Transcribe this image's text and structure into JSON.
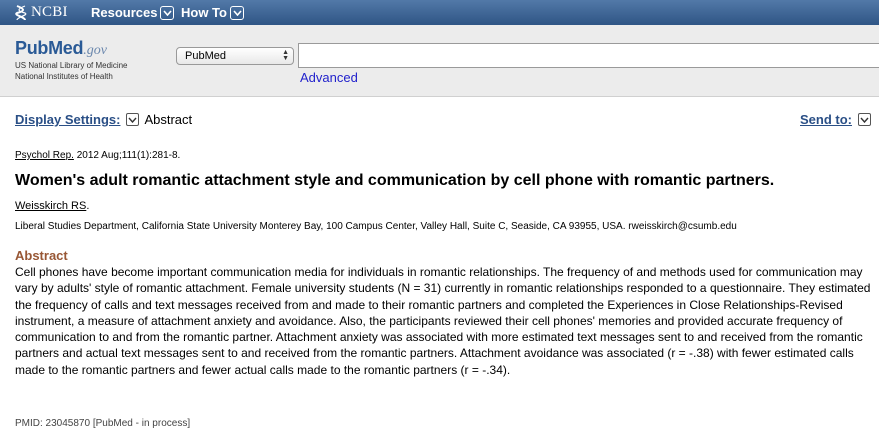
{
  "topbar": {
    "logo_text": "NCBI",
    "nav": [
      {
        "label": "Resources"
      },
      {
        "label": "How To"
      }
    ]
  },
  "header": {
    "logo_word_a": "Pub",
    "logo_word_b": "Med",
    "logo_gov": ".gov",
    "logo_sub_1": "US National Library of Medicine",
    "logo_sub_2": "National Institutes of Health",
    "database": "PubMed",
    "search_value": "",
    "advanced_label": "Advanced"
  },
  "settings": {
    "display_label": "Display Settings:",
    "display_value": "Abstract",
    "send_label": "Send to:"
  },
  "article": {
    "journal": "Psychol Rep.",
    "citation_rest": " 2012 Aug;111(1):281-8.",
    "title": "Women's adult romantic attachment style and communication by cell phone with romantic partners.",
    "author": "Weisskirch RS",
    "author_suffix": ".",
    "affiliation": "Liberal Studies Department, California State University Monterey Bay, 100 Campus Center, Valley Hall, Suite C, Seaside, CA 93955, USA. rweisskirch@csumb.edu",
    "abstract_heading": "Abstract",
    "abstract": "Cell phones have become important communication media for individuals in romantic relationships. The frequency of and methods used for communication may vary by adults' style of romantic attachment. Female university students (N = 31) currently in romantic relationships responded to a questionnaire. They estimated the frequency of calls and text messages received from and made to their romantic partners and completed the Experiences in Close Relationships-Revised instrument, a measure of attachment anxiety and avoidance. Also, the participants reviewed their cell phones' memories and provided accurate frequency of communication to and from the romantic partner. Attachment anxiety was associated with more estimated text messages sent to and received from the romantic partners and actual text messages sent to and received from the romantic partners. Attachment avoidance was associated (r = -.38) with fewer estimated calls made to the romantic partners and fewer actual calls made to the romantic partners (r = -.34).",
    "pmid": "PMID: 23045870 [PubMed - in process]"
  },
  "colors": {
    "topbar": "#3c6291",
    "link": "#2a4f86",
    "abstract_heading": "#985735"
  }
}
